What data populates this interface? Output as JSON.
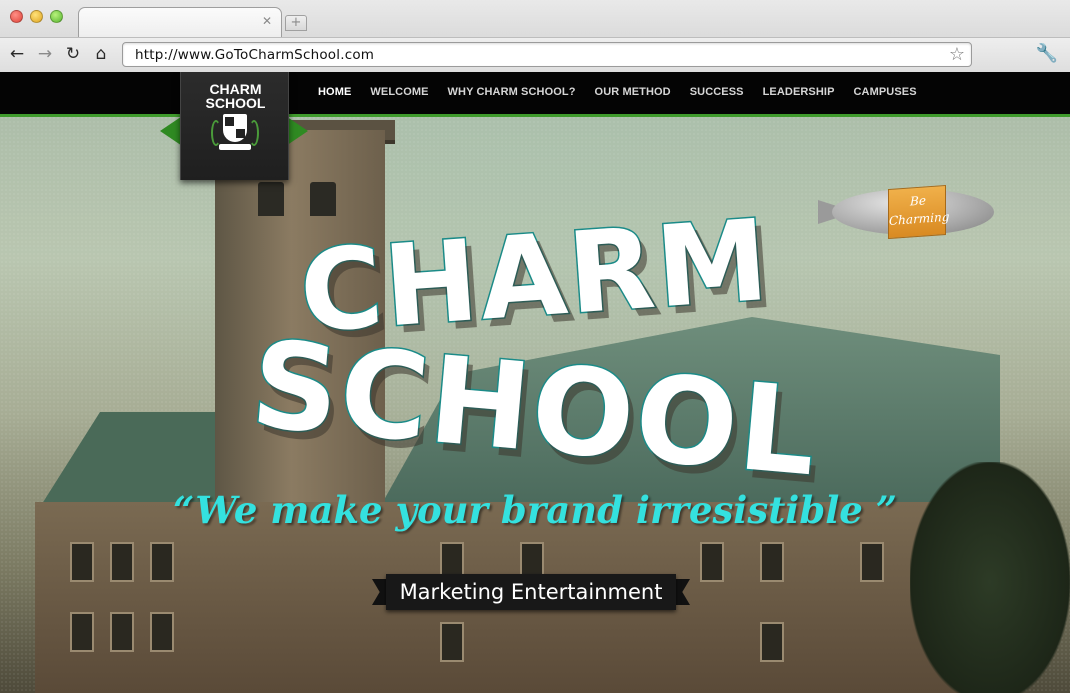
{
  "browser": {
    "url": "http://www.GoToCharmSchool.com",
    "icons": [
      "back-arrow",
      "forward-arrow",
      "reload",
      "home",
      "bookmark-star",
      "wrench-menu"
    ]
  },
  "site": {
    "logo": {
      "line1": "CHARM",
      "line2": "SCHOOL"
    },
    "nav": [
      "HOME",
      "WELCOME",
      "WHY CHARM SCHOOL?",
      "OUR METHOD",
      "SUCCESS",
      "LEADERSHIP",
      "CAMPUSES"
    ],
    "active_nav": "HOME",
    "blimp": {
      "line1": "Be",
      "line2": "Charming"
    },
    "headline": {
      "line1": "CHARM",
      "line2": "SCHOOL"
    },
    "tagline": "“We make your brand irresistible ”",
    "subtitle": "Marketing Entertainment"
  },
  "colors": {
    "nav_accent": "#3f9b2c",
    "headline_outline": "#1b8b88",
    "tagline": "#34e1df",
    "blimp_banner": "#e39a30"
  }
}
